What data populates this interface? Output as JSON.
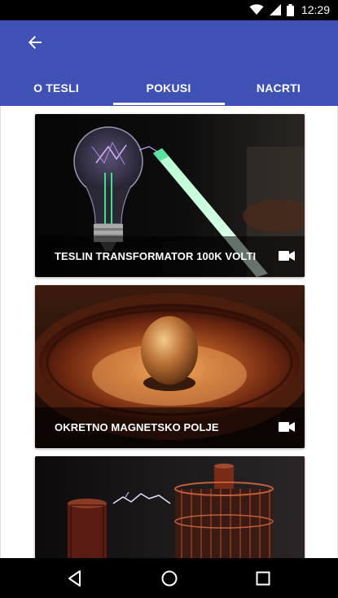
{
  "status_bar": {
    "time": "12:29",
    "icons": [
      "wifi-icon",
      "signal-icon",
      "battery-icon"
    ]
  },
  "app_bar": {
    "back_icon": "arrow-back-icon",
    "background_color": "#3f51b5",
    "tabs": [
      {
        "label": "O TESLI",
        "selected": false
      },
      {
        "label": "POKUSI",
        "selected": true
      },
      {
        "label": "NACRTI",
        "selected": false
      }
    ]
  },
  "cards": [
    {
      "title": "TESLIN TRANSFORMATOR 100K VOLTI",
      "icon": "video-camera-icon"
    },
    {
      "title": "OKRETNO MAGNETSKO POLJE",
      "icon": "video-camera-icon"
    },
    {
      "title": "",
      "icon": ""
    }
  ],
  "nav_bar": {
    "buttons": [
      "back-triangle-icon",
      "home-circle-icon",
      "recents-square-icon"
    ]
  }
}
